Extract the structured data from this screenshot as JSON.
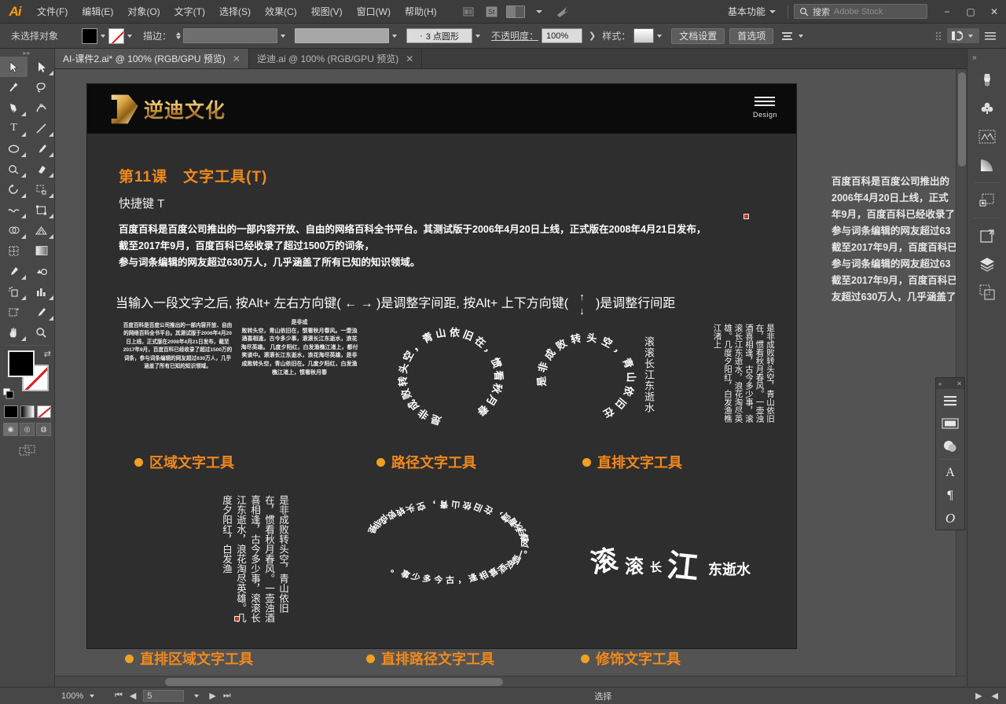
{
  "app": {
    "name": "Adobe Illustrator",
    "logo_text": "Ai"
  },
  "menubar": {
    "items": [
      {
        "label": "文件(F)"
      },
      {
        "label": "编辑(E)"
      },
      {
        "label": "对象(O)"
      },
      {
        "label": "文字(T)"
      },
      {
        "label": "选择(S)"
      },
      {
        "label": "效果(C)"
      },
      {
        "label": "视图(V)"
      },
      {
        "label": "窗口(W)"
      },
      {
        "label": "帮助(H)"
      }
    ],
    "bridge_icon": "bridge-icon",
    "stock_icon": "St",
    "arrange_icon": "arrange-documents-icon",
    "sync_icon": "sync-settings-icon",
    "workspace": "基本功能",
    "search_label": "搜索",
    "search_placeholder": "Adobe Stock",
    "window_minimize": "−",
    "window_maximize": "▢",
    "window_close": "✕"
  },
  "controlbar": {
    "selection_status": "未选择对象",
    "fill_label": "fill-swatch",
    "stroke_label": "stroke-swatch",
    "stroke_text": "描边：",
    "stroke_weight": "",
    "brush_value": "",
    "opacity_prefix": "·",
    "shape_value": "3 点圆形",
    "opacity_label": "不透明度：",
    "opacity_value": "100%",
    "style_label": "样式：",
    "doc_setup": "文档设置",
    "preferences": "首选项",
    "align_label": "align-dropdown",
    "transform_icon": "transform-icon",
    "more_options_icon": "more-options-icon"
  },
  "tabs": [
    {
      "label": "AI-课件2.ai* @ 100% (RGB/GPU 预览)",
      "active": true,
      "close": "✕"
    },
    {
      "label": "逆迪.ai @ 100% (RGB/GPU 预览)",
      "active": false,
      "close": "✕"
    }
  ],
  "toolbox": {
    "tools": [
      {
        "name": "selection-tool",
        "glyph": "➤",
        "selected": true
      },
      {
        "name": "direct-selection-tool",
        "glyph": "➢",
        "selected": false
      },
      {
        "name": "magic-wand-tool",
        "glyph": "✦",
        "selected": false
      },
      {
        "name": "lasso-tool",
        "glyph": "◠",
        "selected": false
      },
      {
        "name": "pen-tool",
        "glyph": "✒",
        "selected": false
      },
      {
        "name": "curvature-tool",
        "glyph": "✎",
        "selected": false
      },
      {
        "name": "type-tool",
        "glyph": "T",
        "selected": false
      },
      {
        "name": "line-segment-tool",
        "glyph": "╱",
        "selected": false
      },
      {
        "name": "ellipse-tool",
        "glyph": "◯",
        "selected": false
      },
      {
        "name": "paintbrush-tool",
        "glyph": "🖌",
        "selected": false
      },
      {
        "name": "shaper-tool",
        "glyph": "◌",
        "selected": false
      },
      {
        "name": "eraser-tool",
        "glyph": "◆",
        "selected": false
      },
      {
        "name": "rotate-tool",
        "glyph": "↺",
        "selected": false
      },
      {
        "name": "scale-tool",
        "glyph": "⤢",
        "selected": false
      },
      {
        "name": "width-tool",
        "glyph": "≈",
        "selected": false
      },
      {
        "name": "free-transform-tool",
        "glyph": "⊞",
        "selected": false
      },
      {
        "name": "shape-builder-tool",
        "glyph": "◑",
        "selected": false
      },
      {
        "name": "perspective-grid-tool",
        "glyph": "◰",
        "selected": false
      },
      {
        "name": "mesh-tool",
        "glyph": "▨",
        "selected": false
      },
      {
        "name": "gradient-tool",
        "glyph": "▭",
        "selected": false
      },
      {
        "name": "eyedropper-tool",
        "glyph": "⚲",
        "selected": false
      },
      {
        "name": "blend-tool",
        "glyph": "◕",
        "selected": false
      },
      {
        "name": "symbol-sprayer-tool",
        "glyph": "⁂",
        "selected": false
      },
      {
        "name": "column-graph-tool",
        "glyph": "▥",
        "selected": false
      },
      {
        "name": "artboard-tool",
        "glyph": "⌗",
        "selected": false
      },
      {
        "name": "slice-tool",
        "glyph": "✂",
        "selected": false
      },
      {
        "name": "hand-tool",
        "glyph": "✋",
        "selected": false
      },
      {
        "name": "zoom-tool",
        "glyph": "🔍",
        "selected": false
      }
    ],
    "fill_color": "#000000",
    "stroke_color": "none",
    "swap_icon": "swap-fill-stroke-icon",
    "default_icon": "default-fill-stroke-icon",
    "color_modes": [
      {
        "name": "color-mode",
        "label": "color"
      },
      {
        "name": "gradient-mode",
        "label": "gradient"
      },
      {
        "name": "none-mode",
        "label": "none"
      }
    ],
    "draw_modes": [
      {
        "name": "draw-normal",
        "glyph": "◉",
        "active": true
      },
      {
        "name": "draw-behind",
        "glyph": "◎",
        "active": false
      },
      {
        "name": "draw-inside",
        "glyph": "◍",
        "active": false
      }
    ],
    "screen_mode": "change-screen-mode-icon"
  },
  "artboard": {
    "logo": {
      "mark": "D",
      "text": "逆迪文化"
    },
    "menu_icon": "hamburger-menu-icon",
    "menu_label": "Design",
    "lesson_title": "第11课　文字工具(T)",
    "shortcut": "快捷键 T",
    "paragraph": "百度百科是百度公司推出的一部内容开放、自由的网络百科全书平台。其测试版于2006年4月20日上线，正式版在2008年4月21日发布，\n截至2017年9月，百度百科已经收录了超过1500万的词条，\n参与词条编辑的网友超过630万人，几乎涵盖了所有已知的知识领域。",
    "hint_before": "当输入一段文字之后, 按Alt+ 左右方向键( ←  → )是调整字间距, 按Alt+ 上下方向键(",
    "hint_after": ")是调整行间距",
    "hint_arrow_up": "↑",
    "hint_arrow_down": "↓",
    "sample_area_text": "百度百科是百度公司推出的一部内容开放、自由的网络百科全书平台。其测试版于2006年4月20日上线，正式版在2008年4月21日发布，截至2017年9月，百度百科已经收录了超过1500万的词条，参与词条编辑的网友超过630万人，几乎涵盖了所有已知的知识领域。",
    "sample_poem_title": "是非成",
    "sample_poem_text": "败转头空，青山依旧在，惯看秋月春风。一壶浊酒喜相逢，古今多少事，滚滚长江东逝水，浪花淘尽英雄。 几度夕阳红，白发渔樵江渚上，都付笑谈中。滚滚长江东逝水，浪花淘尽英雄，是非成败转头空，青山依旧在。几度夕阳红，白发渔樵江渚上，惯看秋月春",
    "path_text_top": "是非成败转头空，青山依旧在，惯看秋月春",
    "path_text_curve": "是非成败转头空，青山依旧在",
    "vertical_text_1": "滚滚长江东逝水",
    "vertical_text_2": "是非成败转头空，青山依旧在，惯看秋月春风。一壶浊酒喜相逢，古今多少事，滚滚长江东逝水，浪花淘尽英雄。几度夕阳红，白发渔樵江渚上",
    "vertical_area_text": "是非成败转头空，青山依旧在，惯看秋月春风。一壶浊酒喜相逢，古今多少事，滚滚长江东逝水，浪花淘尽英雄。几度夕阳红，白发渔",
    "vertical_path_text": "是非成败转头空，青山依旧在，惯看秋月春风。一壶浊酒喜相逢，古今多少事。",
    "touch_text": "滚滚长江东逝水",
    "labels_row1": [
      {
        "text": "区域文字工具"
      },
      {
        "text": "路径文字工具"
      },
      {
        "text": "直排文字工具"
      }
    ],
    "labels_row2": [
      {
        "text": "直排区域文字工具"
      },
      {
        "text": "直排路径文字工具"
      },
      {
        "text": "修饰文字工具"
      }
    ],
    "overflow_text": "百度百科是百度公司推出的\n2006年4月20日上线，正式\n年9月，百度百科已经收录了\n参与词条编辑的网友超过63\n截至2017年9月，百度百科已\n参与词条编辑的网友超过63\n截至2017年9月，百度百科已\n友超过630万人，几乎涵盖了",
    "colors": {
      "accent_orange": "#f0891d",
      "dot_orange": "#f0a120",
      "header_black": "#0b0b0b",
      "artboard_bg": "#2e2e2e"
    }
  },
  "right_dock": {
    "collapse_icon": "collapse-panels-icon",
    "items": [
      {
        "name": "brushes-panel-icon",
        "glyph": "brush"
      },
      {
        "name": "symbols-panel-icon",
        "glyph": "club"
      },
      {
        "name": "image-trace-panel-icon",
        "glyph": "trace"
      },
      {
        "name": "gradient-panel-icon",
        "glyph": "gradient"
      },
      {
        "name": "transform-panel-icon",
        "glyph": "transform"
      },
      {
        "name": "artboards-panel-icon",
        "glyph": "artboard"
      },
      {
        "name": "layers-panel-icon",
        "glyph": "layers"
      },
      {
        "name": "libraries-panel-icon",
        "glyph": "libraries"
      }
    ]
  },
  "float_panel": {
    "collapse_icon": "«",
    "close_icon": "✕",
    "items": [
      {
        "name": "paragraph-styles-icon",
        "glyph": "lines"
      },
      {
        "name": "swatches-panel-icon",
        "glyph": "swatch"
      },
      {
        "name": "color-panel-icon",
        "glyph": "color"
      },
      {
        "name": "character-panel-icon",
        "glyph": "A"
      },
      {
        "name": "paragraph-panel-icon",
        "glyph": "¶"
      },
      {
        "name": "glyphs-panel-icon",
        "glyph": "O"
      }
    ]
  },
  "statusbar": {
    "zoom": "100%",
    "first_icon": "⏮",
    "prev_icon": "◀",
    "page": "5",
    "next_icon": "▶",
    "last_icon": "⏭",
    "status_text": "选择",
    "right_arrow": "▶",
    "left_arrow": "◀"
  }
}
